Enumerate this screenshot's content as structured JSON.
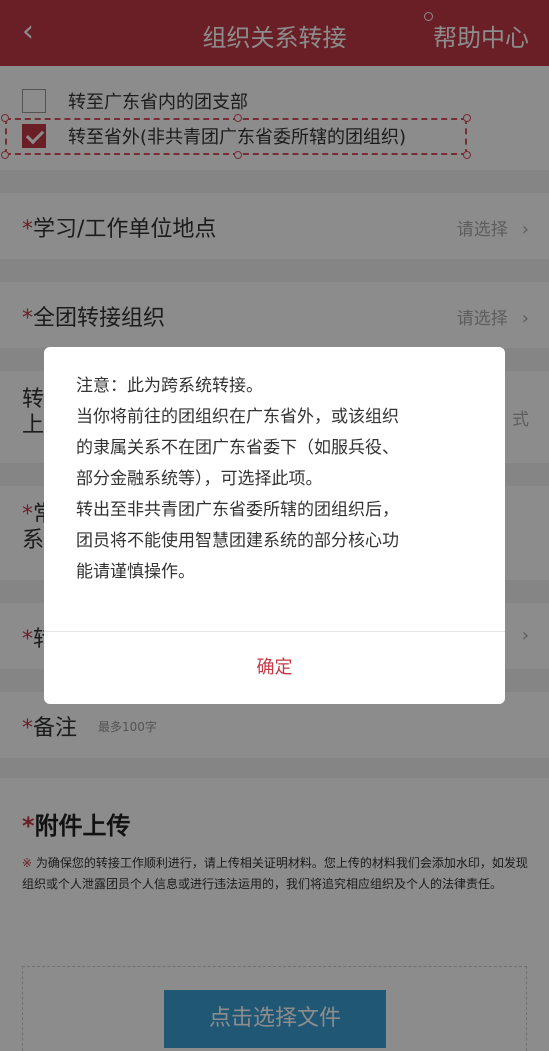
{
  "header": {
    "back_icon": "chevron-left-icon",
    "title": "组织关系转接",
    "help_label": "帮助中心"
  },
  "options": [
    {
      "label": "转至广东省内的团支部",
      "checked": false
    },
    {
      "label": "转至省外(非共青团广东省委所辖的团组织)",
      "checked": true
    }
  ],
  "form": {
    "star": "*",
    "location": {
      "label": "学习/工作单位地点",
      "placeholder": "请选择"
    },
    "target_org": {
      "label": "全团转接组织",
      "placeholder": "请选择"
    },
    "row3": {
      "label_line1": "转",
      "label_line2": "上",
      "right_text": "式"
    },
    "row4": {
      "label_line1": "常",
      "label_line2": "系"
    },
    "row5": {
      "label": "转"
    },
    "remark": {
      "label": "备注",
      "hint": "最多100字"
    }
  },
  "attachment": {
    "title": "附件上传",
    "notice_mark": "※",
    "notice": "为确保您的转接工作顺利进行，请上传相关证明材料。您上传的材料我们会添加水印，如发现组织或个人泄露团员个人信息或进行违法运用的，我们将追究相应组织及个人的法律责任。",
    "upload_button": "点击选择文件"
  },
  "dialog": {
    "lines": [
      "注意：此为跨系统转接。",
      "当你将前往的团组织在广东省外，或该组织",
      "的隶属关系不在团广东省委下（如服兵役、",
      "部分金融系统等），可选择此项。",
      "转出至非共青团广东省委所辖的团组织后，",
      "团员将不能使用智慧团建系统的部分核心功",
      "能请谨慎操作。"
    ],
    "confirm_label": "确定"
  },
  "colors": {
    "brand": "#c23a45",
    "upload": "#3a9fd5"
  }
}
